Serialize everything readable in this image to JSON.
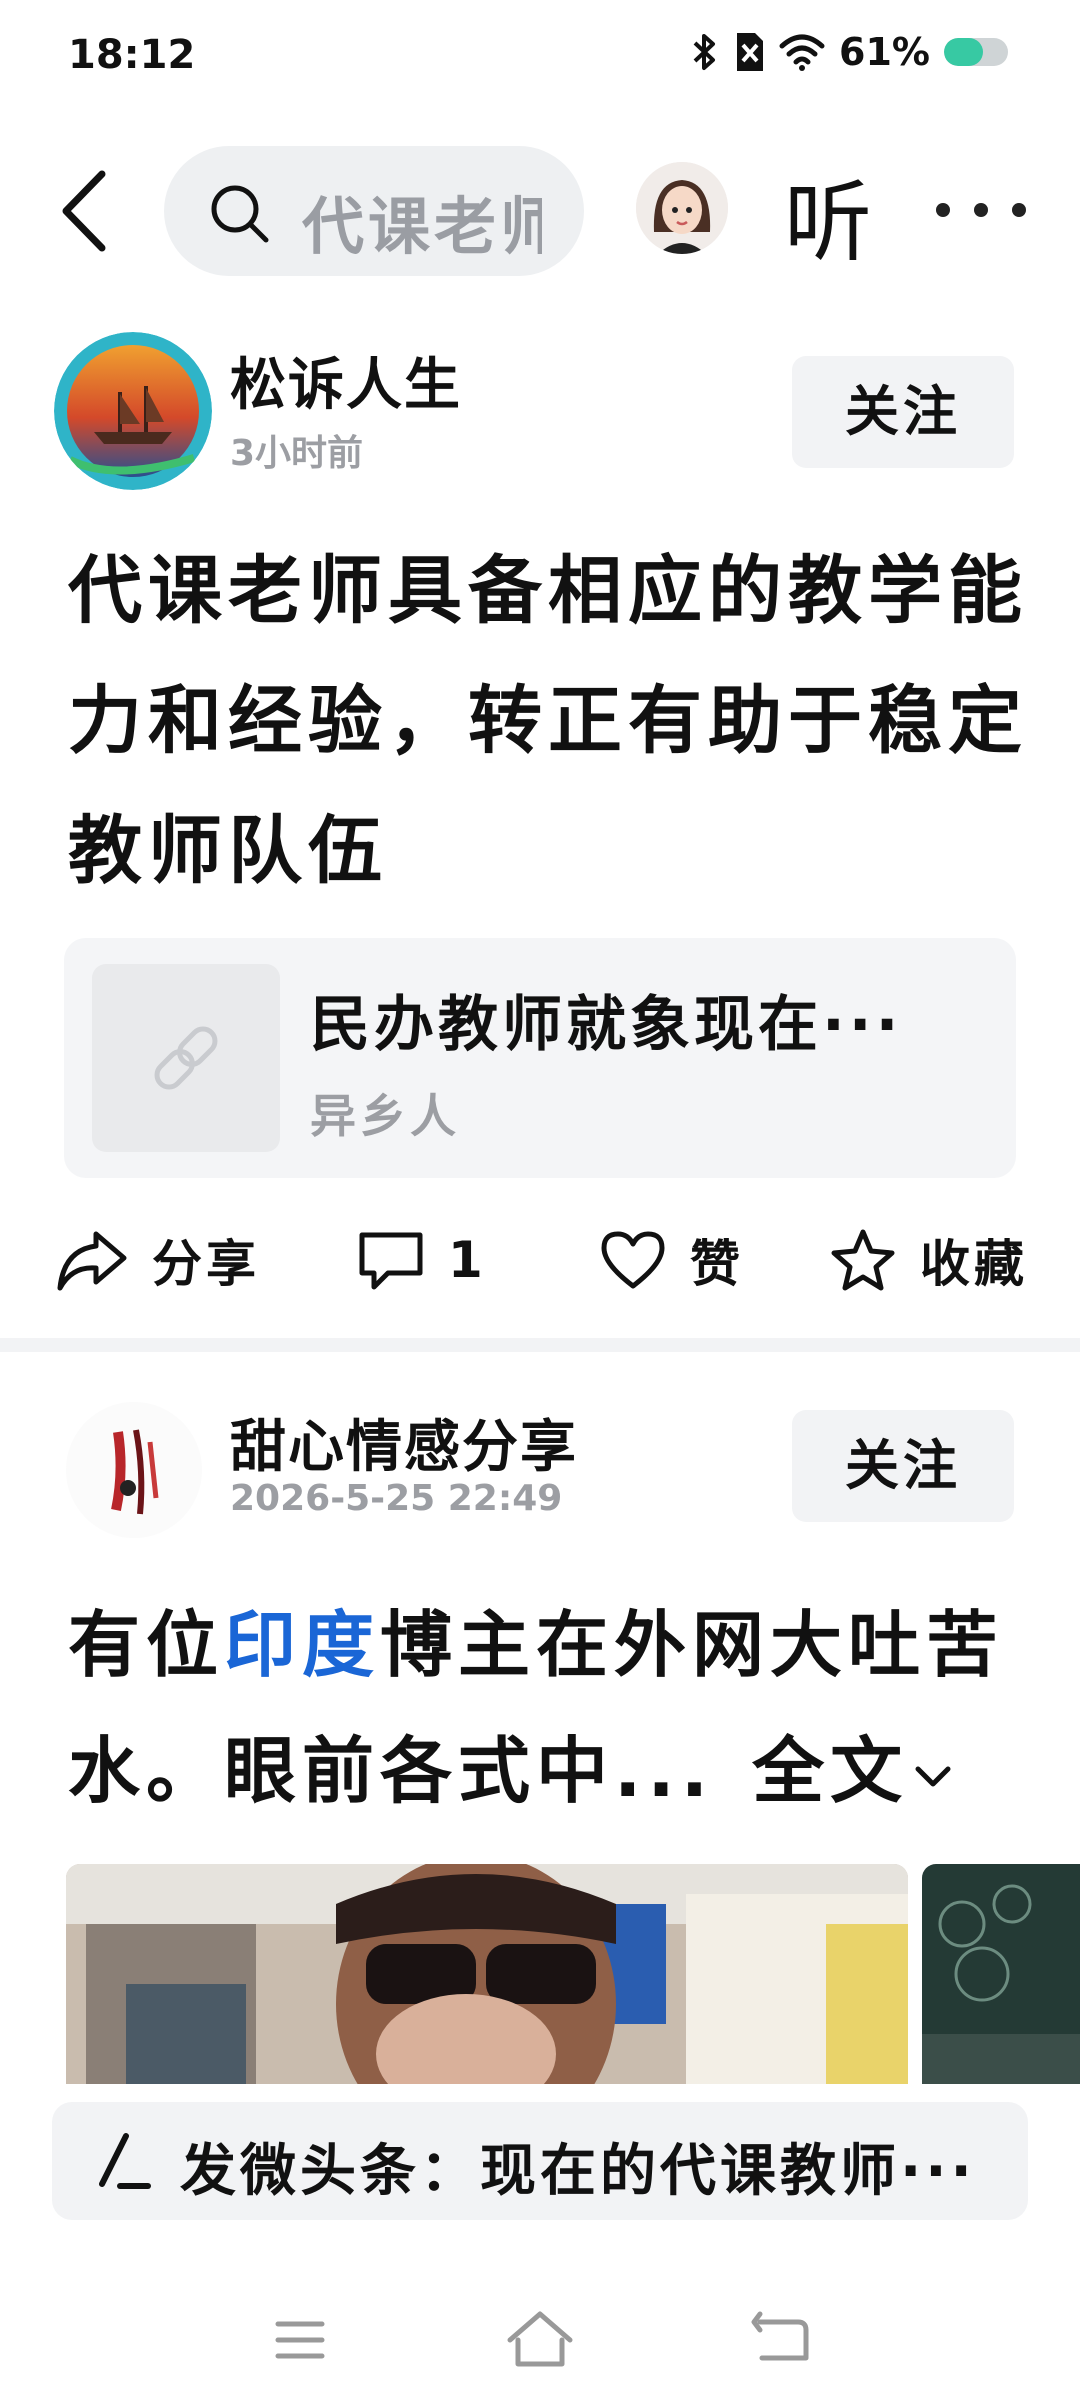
{
  "status_bar": {
    "time": "18:12",
    "battery_text": "61%",
    "battery_level": 0.61,
    "icons": [
      "bluetooth-icon",
      "no-sim-icon",
      "wifi-icon",
      "battery-icon"
    ]
  },
  "top_nav": {
    "search_text": "代课老师",
    "listen_label": "听",
    "icons": [
      "back-icon",
      "search-icon",
      "more-icon"
    ]
  },
  "post1": {
    "author": "松诉人生",
    "time": "3小时前",
    "follow_label": "关注",
    "title_lines": [
      "代课老师具备相应的教学能",
      "力和经验，转正有助于稳定",
      "教师队伍"
    ],
    "link_card": {
      "title": "民办教师就象现在···",
      "source": "异乡人",
      "icon": "link-icon"
    },
    "actions": {
      "share": "分享",
      "comment_count": "1",
      "like": "赞",
      "favorite": "收藏"
    }
  },
  "post2": {
    "author": "甜心情感分享",
    "time": "2026-5-25 22:49",
    "follow_label": "关注",
    "text_before": "有位",
    "text_highlight": "印度",
    "text_after_line1": "博主在外网大吐苦",
    "text_line2": "水。眼前各式中...",
    "fulltext_label": "全文"
  },
  "compose": {
    "text": "发微头条：现在的代课教师···",
    "icon": "pen-icon"
  },
  "system_nav": {
    "icons": [
      "menu-icon",
      "home-icon",
      "back-nav-icon"
    ]
  },
  "colors": {
    "highlight": "#1a66d6",
    "battery_fill": "#37c9a3",
    "muted_text": "#9c9ea3",
    "card_bg": "#f4f5f7"
  }
}
